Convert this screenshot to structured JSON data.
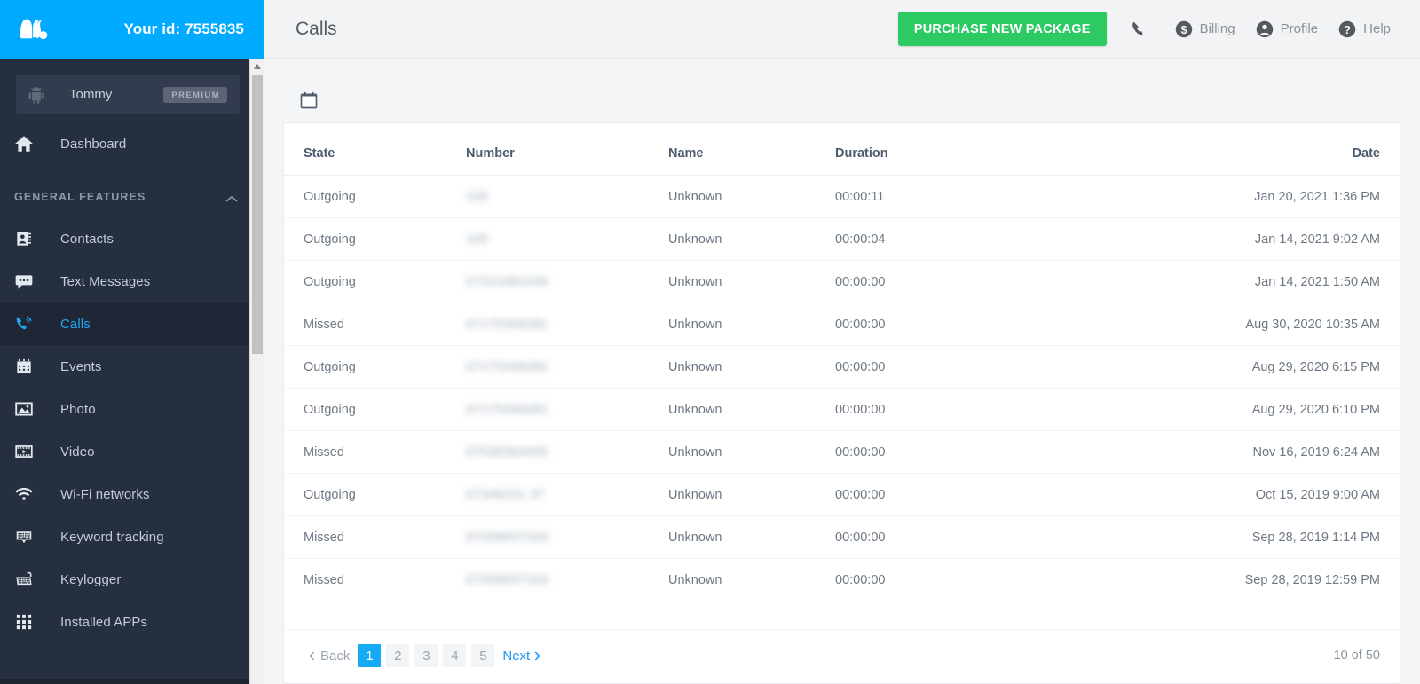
{
  "brand": {
    "logo_icon": "mspy-m-logo",
    "account_id_label": "Your id: 7555835"
  },
  "device": {
    "platform_icon": "android-robot-icon",
    "name": "Tommy",
    "plan_badge": "PREMIUM"
  },
  "sidebar": {
    "dashboard": {
      "label": "Dashboard",
      "icon": "home-icon"
    },
    "section_label": "GENERAL FEATURES",
    "section_chevron_icon": "chevron-up-icon",
    "items": [
      {
        "label": "Contacts",
        "icon": "contact-book-icon",
        "active": false
      },
      {
        "label": "Text Messages",
        "icon": "chat-bubble-icon",
        "active": false
      },
      {
        "label": "Calls",
        "icon": "phone-ring-icon",
        "active": true
      },
      {
        "label": "Events",
        "icon": "calendar-events-icon",
        "active": false
      },
      {
        "label": "Photo",
        "icon": "image-icon",
        "active": false
      },
      {
        "label": "Video",
        "icon": "film-strip-icon",
        "active": false
      },
      {
        "label": "Wi-Fi networks",
        "icon": "wifi-icon",
        "active": false
      },
      {
        "label": "Keyword tracking",
        "icon": "keyboard-alert-icon",
        "active": false
      },
      {
        "label": "Keylogger",
        "icon": "keyboard-icon",
        "active": false
      },
      {
        "label": "Installed APPs",
        "icon": "grid-dots-icon",
        "active": false
      }
    ],
    "scrollbar": {
      "up_arrow_icon": "scroll-up-arrow-icon"
    }
  },
  "header": {
    "page_title": "Calls",
    "purchase_button": "PURCHASE NEW PACKAGE",
    "links": [
      {
        "label": "",
        "icon": "phone-handset-icon"
      },
      {
        "label": "Billing",
        "icon": "dollar-circle-icon"
      },
      {
        "label": "Profile",
        "icon": "person-circle-icon"
      },
      {
        "label": "Help",
        "icon": "question-circle-icon"
      }
    ]
  },
  "toolbar": {
    "date_filter_icon": "calendar-icon"
  },
  "table": {
    "columns": [
      "State",
      "Number",
      "Name",
      "Duration",
      "Date"
    ],
    "rows": [
      {
        "state": "Outgoing",
        "number": "100",
        "number_redacted": true,
        "name": "Unknown",
        "duration": "00:00:11",
        "date": "Jan 20, 2021 1:36 PM"
      },
      {
        "state": "Outgoing",
        "number": "100",
        "number_redacted": true,
        "name": "Unknown",
        "duration": "00:00:04",
        "date": "Jan 14, 2021 9:02 AM"
      },
      {
        "state": "Outgoing",
        "number": "07221681436",
        "number_redacted": true,
        "name": "Unknown",
        "duration": "00:00:00",
        "date": "Jan 14, 2021 1:50 AM"
      },
      {
        "state": "Missed",
        "number": "07175346281",
        "number_redacted": true,
        "name": "Unknown",
        "duration": "00:00:00",
        "date": "Aug 30, 2020 10:35 AM"
      },
      {
        "state": "Outgoing",
        "number": "07175346281",
        "number_redacted": true,
        "name": "Unknown",
        "duration": "00:00:00",
        "date": "Aug 29, 2020 6:15 PM"
      },
      {
        "state": "Outgoing",
        "number": "07175346281",
        "number_redacted": true,
        "name": "Unknown",
        "duration": "00:00:00",
        "date": "Aug 29, 2020 6:10 PM"
      },
      {
        "state": "Missed",
        "number": "07536364495",
        "number_redacted": true,
        "name": "Unknown",
        "duration": "00:00:00",
        "date": "Nov 16, 2019 6:24 AM"
      },
      {
        "state": "Outgoing",
        "number": "07346231 37",
        "number_redacted": true,
        "name": "Unknown",
        "duration": "00:00:00",
        "date": "Oct 15, 2019 9:00 AM"
      },
      {
        "state": "Missed",
        "number": "07209637163",
        "number_redacted": true,
        "name": "Unknown",
        "duration": "00:00:00",
        "date": "Sep 28, 2019 1:14 PM"
      },
      {
        "state": "Missed",
        "number": "07209637163",
        "number_redacted": true,
        "name": "Unknown",
        "duration": "00:00:00",
        "date": "Sep 28, 2019 12:59 PM"
      }
    ]
  },
  "pagination": {
    "back_label": "Back",
    "next_label": "Next",
    "pages": [
      "1",
      "2",
      "3",
      "4",
      "5"
    ],
    "current_page": "1",
    "count_label": "10 of 50"
  },
  "colors": {
    "brand_blue": "#00aaff",
    "sidebar_bg": "#262f3f",
    "sidebar_active_bg": "#1f2736",
    "accent_blue": "#1fa8f2",
    "purchase_green": "#2dc963",
    "page_bg": "#f4f5f7"
  }
}
